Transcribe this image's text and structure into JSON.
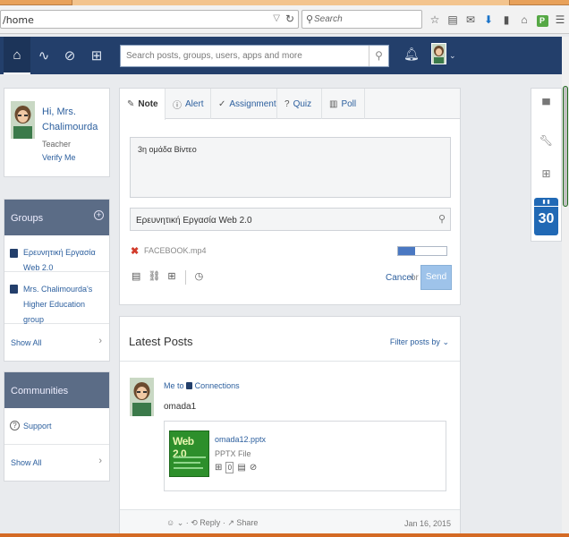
{
  "browser": {
    "url": "/home",
    "search_placeholder": "Search",
    "icons": [
      "star-icon",
      "reading-list-icon",
      "mail-icon",
      "download-icon",
      "library-icon",
      "home-icon",
      "extension-icon",
      "menu-icon"
    ]
  },
  "nav": {
    "search_placeholder": "Search posts, groups, users, apps and more",
    "icons": [
      "home-icon",
      "activity-icon",
      "discover-icon",
      "backpack-icon",
      "notifications-icon"
    ]
  },
  "profile": {
    "greeting": "Hi, Mrs. Chalimourda",
    "role": "Teacher",
    "verify": "Verify Me"
  },
  "groups": {
    "title": "Groups",
    "items": [
      {
        "label": "Ερευνητική Εργασία Web 2.0"
      },
      {
        "label": "Mrs. Chalimourda's Higher Education group"
      }
    ],
    "show_all": "Show All"
  },
  "communities": {
    "title": "Communities",
    "items": [
      {
        "label": "Support"
      }
    ],
    "show_all": "Show All"
  },
  "composer": {
    "tabs": [
      {
        "label": "Note",
        "icon": "note-icon"
      },
      {
        "label": "Alert",
        "icon": "alert-icon"
      },
      {
        "label": "Assignment",
        "icon": "assignment-icon"
      },
      {
        "label": "Quiz",
        "icon": "quiz-icon"
      },
      {
        "label": "Poll",
        "icon": "poll-icon"
      }
    ],
    "message": "3η ομάδα Βίντεο",
    "recipient": "Ερευνητική Εργασία Web 2.0",
    "attachment": "FACEBOOK.mp4",
    "upload_progress": 0.35,
    "cancel": "Cancel",
    "or": "or",
    "send": "Send"
  },
  "feed": {
    "title": "Latest Posts",
    "filter": "Filter posts by",
    "post": {
      "sender": "Me",
      "to": "to",
      "recipient": "Connections",
      "body": "omada1",
      "file_name": "omada12.pptx",
      "file_type": "PPTX File",
      "thumb_text": "Web 2.0",
      "count": "0",
      "reply": "Reply",
      "share": "Share",
      "date": "Jan 16, 2015"
    }
  },
  "rail": {
    "calendar_day": "30"
  },
  "colors": {
    "nav": "#233f6b",
    "link": "#2c5f9e",
    "section_header": "#5b6c86",
    "send_disabled": "#9ec3ea",
    "attachment_remove": "#d23b2b"
  }
}
